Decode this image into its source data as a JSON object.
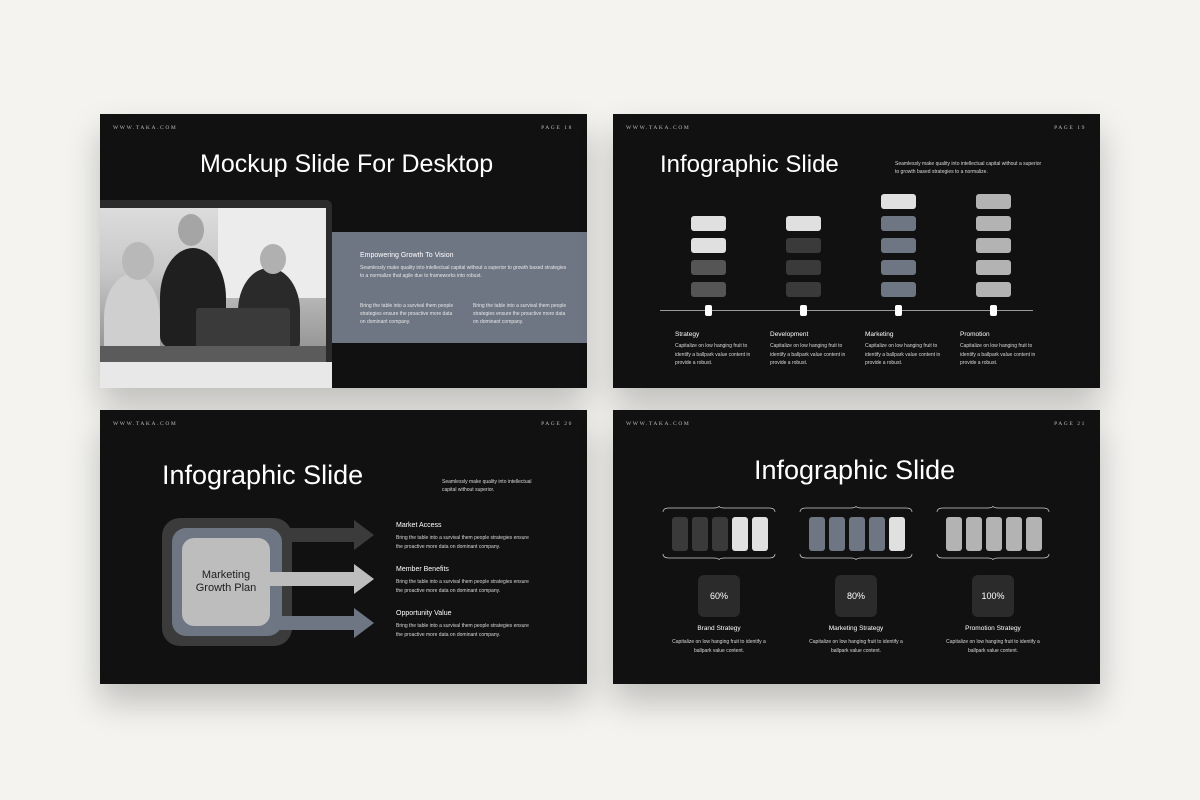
{
  "site_label": "WWW.TAKA.COM",
  "slides": {
    "desktop": {
      "page": "PAGE 18",
      "title": "Mockup Slide For Desktop",
      "heading": "Empowering Growth To Vision",
      "para1": "Seamlessly make quality into intellectual capital without a superior to growth based strategies to a normalize that agile due to frameworks into robust.",
      "para2": "Bring the table into a survival them people strategies ensure the proactive more data on dominant company.",
      "para3": "Bring the table into a survival them people strategies ensure the proactive more data on dominant company."
    },
    "timeline": {
      "page": "PAGE 19",
      "title": "Infographic Slide",
      "intro": "Seamlessly make quality into intellectual capital without a superior to growth based strategies to a normalize.",
      "stages": [
        {
          "label": "Strategy",
          "text": "Capitalize on low hanging fruit to identify a ballpark value content in provide a robust."
        },
        {
          "label": "Development",
          "text": "Capitalize on low hanging fruit to identify a ballpark value content in provide a robust."
        },
        {
          "label": "Marketing",
          "text": "Capitalize on low hanging fruit to identify a ballpark value content in provide a robust."
        },
        {
          "label": "Promotion",
          "text": "Capitalize on low hanging fruit to identify a ballpark value content in provide a robust."
        }
      ],
      "colors": {
        "light": "#e0e0e0",
        "dark": "#3a3a3a",
        "mid": "#555555",
        "slate": "#6e7583",
        "grey": "#b3b3b3"
      }
    },
    "growth": {
      "page": "PAGE 20",
      "title": "Infographic Slide",
      "intro": "Seamlessly make quality into intellectual capital without superior.",
      "center": "Marketing Growth Plan",
      "items": [
        {
          "label": "Market Access",
          "text": "Bring the table into a survival them people strategies ensure the proactive more data on dominant company."
        },
        {
          "label": "Member Benefits",
          "text": "Bring the table into a survival them people strategies ensure the proactive more data on dominant company."
        },
        {
          "label": "Opportunity Value",
          "text": "Bring the table into a survival them people strategies ensure the proactive more data on dominant company."
        }
      ]
    },
    "strategy": {
      "page": "PAGE 21",
      "title": "Infographic Slide",
      "groups": [
        {
          "percent": "60%",
          "name": "Brand Strategy",
          "text": "Capitalize on low hanging fruit to identify a ballpark value content."
        },
        {
          "percent": "80%",
          "name": "Marketing Strategy",
          "text": "Capitalize on low hanging fruit to identify a ballpark value content."
        },
        {
          "percent": "100%",
          "name": "Promotion Strategy",
          "text": "Capitalize on low hanging fruit to identify a ballpark value content."
        }
      ]
    }
  }
}
